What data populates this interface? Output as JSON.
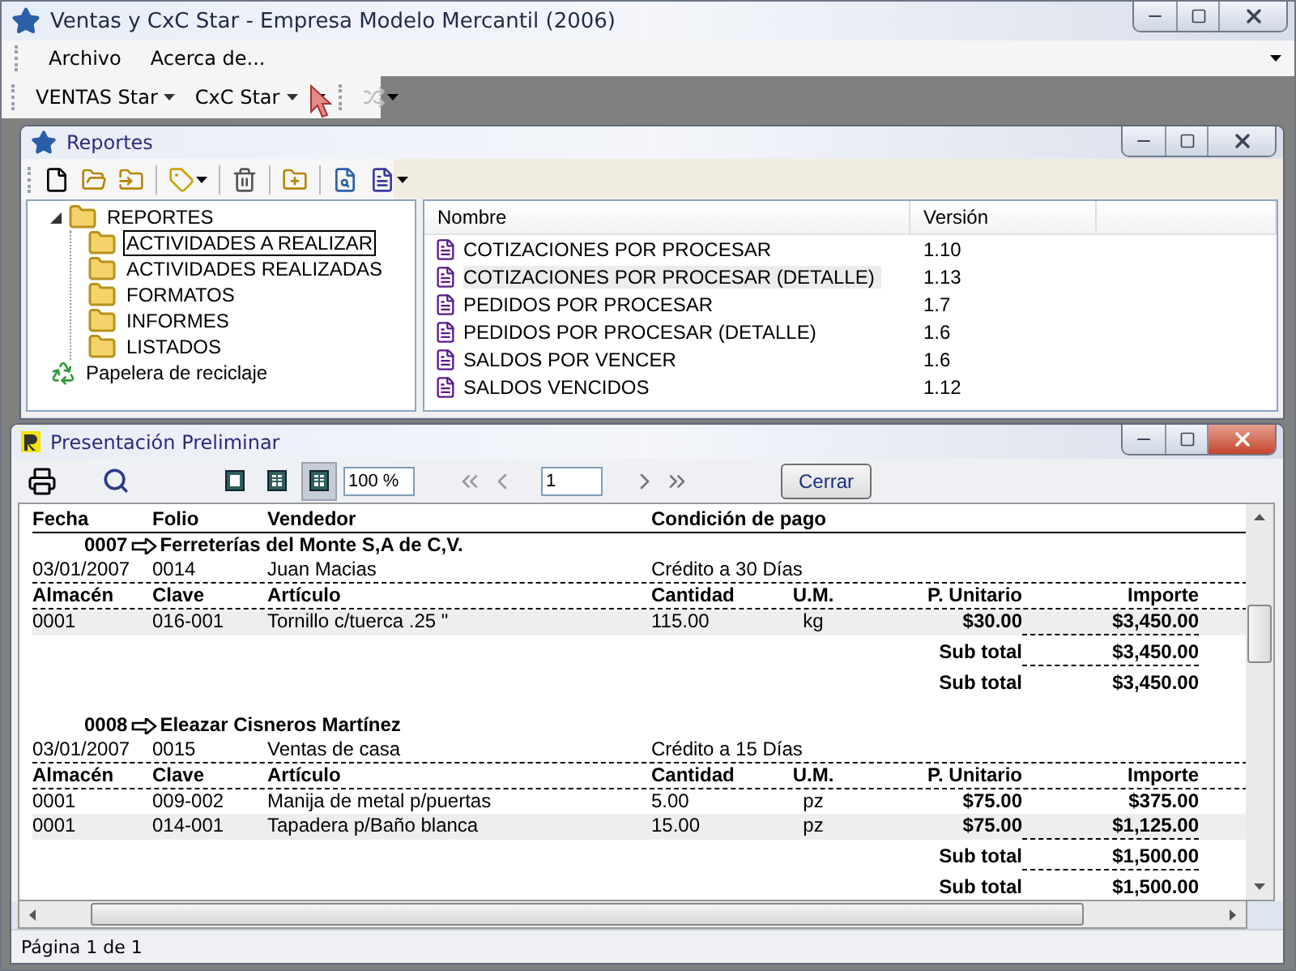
{
  "window": {
    "title": "Ventas y CxC Star - Empresa Modelo Mercantil (2006)"
  },
  "menu": [
    "Archivo",
    "Acerca de..."
  ],
  "toolbar": [
    {
      "label": "VENTAS Star"
    },
    {
      "label": "CxC Star"
    }
  ],
  "reportes": {
    "title": "Reportes",
    "tree": {
      "label": "REPORTES",
      "expanded": true,
      "children": [
        {
          "label": "ACTIVIDADES A REALIZAR",
          "selected": true
        },
        {
          "label": "ACTIVIDADES REALIZADAS",
          "selected": false
        },
        {
          "label": "FORMATOS",
          "selected": false
        },
        {
          "label": "INFORMES",
          "selected": false
        },
        {
          "label": "LISTADOS",
          "selected": false
        }
      ]
    },
    "recycle_bin": "Papelera de reciclaje",
    "columns": [
      "Nombre",
      "Versión"
    ],
    "rows": [
      {
        "name": "COTIZACIONES POR PROCESAR",
        "version": "1.10",
        "selected": false
      },
      {
        "name": "COTIZACIONES POR PROCESAR (DETALLE)",
        "version": "1.13",
        "selected": true
      },
      {
        "name": "PEDIDOS POR PROCESAR",
        "version": "1.7",
        "selected": false
      },
      {
        "name": "PEDIDOS POR PROCESAR (DETALLE)",
        "version": "1.6",
        "selected": false
      },
      {
        "name": "SALDOS POR VENCER",
        "version": "1.6",
        "selected": false
      },
      {
        "name": "SALDOS VENCIDOS",
        "version": "1.12",
        "selected": false
      }
    ]
  },
  "preview": {
    "title": "Presentación Preliminar",
    "view_modes": [
      {
        "selected": false
      },
      {
        "selected": false
      },
      {
        "selected": true
      }
    ],
    "zoom": "100 %",
    "page": "1",
    "close_button": "Cerrar",
    "report": {
      "columns": [
        "Fecha",
        "Folio",
        "Vendedor",
        "Condición de pago"
      ],
      "groups": [
        {
          "code": "0007",
          "customer": "Ferreterías del Monte S,A de C,V.",
          "fecha": "03/01/2007",
          "folio": "0014",
          "vendedor": "Juan Macias",
          "condicion": "Crédito a 30 Días",
          "item_columns": [
            "Almacén",
            "Clave",
            "Artículo",
            "Cantidad",
            "U.M.",
            "P. Unitario",
            "Importe"
          ],
          "items": [
            {
              "cells": [
                "0001",
                "016-001",
                "Tornillo c/tuerca .25 \"",
                "115.00",
                "kg",
                "$30.00",
                "$3,450.00"
              ],
              "shaded": true
            }
          ],
          "subtotals": [
            {
              "label": "Sub total",
              "value": "$3,450.00"
            },
            {
              "label": "Sub total",
              "value": "$3,450.00"
            }
          ]
        },
        {
          "code": "0008",
          "customer": "Eleazar Cisneros Martínez",
          "fecha": "03/01/2007",
          "folio": "0015",
          "vendedor": "Ventas de casa",
          "condicion": "Crédito a 15 Días",
          "item_columns": [
            "Almacén",
            "Clave",
            "Artículo",
            "Cantidad",
            "U.M.",
            "P. Unitario",
            "Importe"
          ],
          "items": [
            {
              "cells": [
                "0001",
                "009-002",
                "Manija de metal p/puertas",
                "5.00",
                "pz",
                "$75.00",
                "$375.00"
              ],
              "shaded": false
            },
            {
              "cells": [
                "0001",
                "014-001",
                "Tapadera p/Baño blanca",
                "15.00",
                "pz",
                "$75.00",
                "$1,125.00"
              ],
              "shaded": true
            }
          ],
          "subtotals": [
            {
              "label": "Sub total",
              "value": "$1,500.00"
            },
            {
              "label": "Sub total",
              "value": "$1,500.00"
            }
          ]
        }
      ]
    },
    "status": "Página 1 de 1"
  }
}
